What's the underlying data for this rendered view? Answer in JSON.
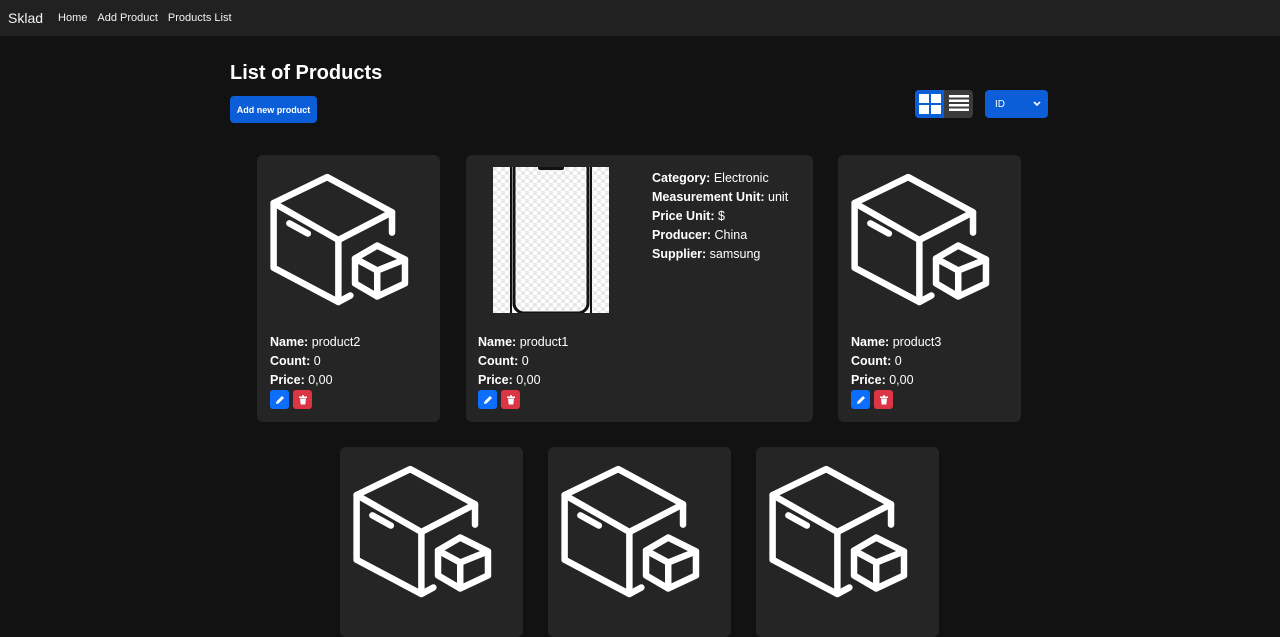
{
  "navbar": {
    "brand": "Sklad",
    "links": [
      "Home",
      "Add Product",
      "Products List"
    ]
  },
  "page": {
    "title": "List of Products",
    "add_button": "Add new product",
    "sort_value": "ID",
    "view_mode": "grid"
  },
  "labels": {
    "name": "Name:",
    "count": "Count:",
    "price": "Price:",
    "category": "Category:",
    "measurement_unit": "Measurement Unit:",
    "price_unit": "Price Unit:",
    "producer": "Producer:",
    "supplier": "Supplier:"
  },
  "products": [
    {
      "name": "product2",
      "count": "0",
      "price": "0,00"
    },
    {
      "name": "product1",
      "count": "0",
      "price": "0,00",
      "category": "Electronic",
      "measurement_unit": "unit",
      "price_unit": "$",
      "producer": "China",
      "supplier": "samsung"
    },
    {
      "name": "product3",
      "count": "0",
      "price": "0,00"
    }
  ],
  "colors": {
    "primary": "#0b5ed7",
    "danger": "#dc3545",
    "card_bg": "#252525",
    "page_bg": "#121212"
  }
}
